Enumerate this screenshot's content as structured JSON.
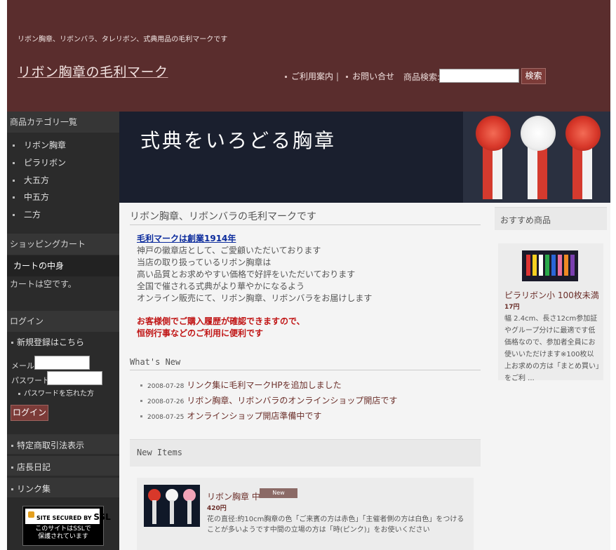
{
  "header": {
    "tagline": "リボン胸章、リボンバラ、タレリボン、式典用品の毛利マークです",
    "site_title": "リボン胸章の毛利マーク",
    "nav": [
      "ご利用案内",
      "お問い合せ"
    ],
    "nav_separator": "|",
    "search_label": "商品検索:",
    "search_value": "",
    "search_button": "検索"
  },
  "sidebar": {
    "categories_title": "商品カテゴリ一覧",
    "categories": [
      "リボン胸章",
      "ピラリボン",
      "大五方",
      "中五方",
      "二方"
    ],
    "cart_title": "ショッピングカート",
    "cart_content_label": "カートの中身",
    "cart_empty": "カートは空です。",
    "login_title": "ログイン",
    "register_link": "新規登録はこちら",
    "email_label": "メール:",
    "email_value": "",
    "password_label": "パスワード:",
    "password_value": "",
    "forgot_link": "パスワードを忘れた方",
    "login_button": "ログイン",
    "links": [
      "特定商取引法表示",
      "店長日記",
      "リンク集"
    ],
    "ssl_top_small": "SITE SECURED BY",
    "ssl_top_big": "SSL",
    "ssl_line1": "このサイトはSSLで",
    "ssl_line2": "保護されています"
  },
  "banner": {
    "text": "式典をいろどる胸章"
  },
  "main": {
    "title": "リボン胸章、リボンバラの毛利マークです",
    "founded_link": "毛利マークは創業1914年",
    "intro_lines": [
      "神戸の徽章店として、ご愛顧いただいております",
      "当店の取り扱っているリボン胸章は",
      "高い品質とお求めやすい価格で好評をいただいております",
      "全国で催される式典がより華やかになるよう",
      "オンライン販売にて、リボン胸章、リボンバラをお届けします"
    ],
    "notice_lines": [
      "お客様側でご購入履歴が確認できますので、",
      "恒例行事などのご利用に便利です"
    ],
    "whats_new_title": "What's New",
    "news": [
      {
        "date": "2008-07-28",
        "text": "リンク集に毛利マークHPを追加しました"
      },
      {
        "date": "2008-07-26",
        "text": "リボン胸章、リボンバラのオンラインショップ開店です"
      },
      {
        "date": "2008-07-25",
        "text": "オンラインショップ開店準備中です"
      }
    ],
    "new_items_title": "New Items",
    "item": {
      "name": "リボン胸章 中",
      "badge": "New",
      "price": "420円",
      "desc": "花の直径:約10cm胸章の色「ご来賓の方は赤色」「主催者側の方は白色」をつけることが多いようです中間の立場の方は「時(ピンク)」をお使いください"
    }
  },
  "right": {
    "title": "おすすめ商品",
    "item": {
      "name": "ピラリボン小 100枚未満",
      "price": "17円",
      "desc": "幅 2.4cm、長さ12cm参加証やグループ分けに最適です低価格なので、参加者全員にお使いいただけます※100枚以上お求めの方は「まとめ買い」をご利 ..."
    }
  },
  "colors": {
    "header_bg": "#5a2d2d",
    "sidebar_bg": "#2b2b2b",
    "accent": "#7c3b38",
    "notice_red": "#c01515",
    "link_blue": "#0a2a9c"
  },
  "icons": [
    "lock-icon",
    "bullet-icon",
    "rosette-image",
    "ribbon-strips-image"
  ]
}
